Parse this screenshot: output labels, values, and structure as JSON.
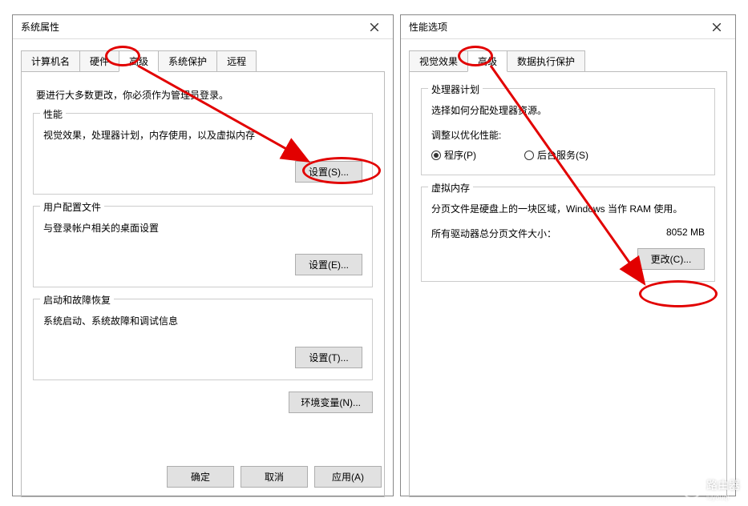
{
  "left": {
    "title": "系统属性",
    "tabs": [
      "计算机名",
      "硬件",
      "高级",
      "系统保护",
      "远程"
    ],
    "active_tab": 2,
    "admin_notice": "要进行大多数更改，你必须作为管理员登录。",
    "perf": {
      "title": "性能",
      "desc": "视觉效果，处理器计划，内存使用，以及虚拟内存",
      "button": "设置(S)..."
    },
    "profiles": {
      "title": "用户配置文件",
      "desc": "与登录帐户相关的桌面设置",
      "button": "设置(E)..."
    },
    "startup": {
      "title": "启动和故障恢复",
      "desc": "系统启动、系统故障和调试信息",
      "button": "设置(T)..."
    },
    "envvars_button": "环境变量(N)...",
    "footer": {
      "ok": "确定",
      "cancel": "取消",
      "apply": "应用(A)"
    }
  },
  "right": {
    "title": "性能选项",
    "tabs": [
      "视觉效果",
      "高级",
      "数据执行保护"
    ],
    "active_tab": 1,
    "sched": {
      "title": "处理器计划",
      "desc": "选择如何分配处理器资源。",
      "adjust_label": "调整以优化性能:",
      "opt_programs": "程序(P)",
      "opt_background": "后台服务(S)"
    },
    "vmem": {
      "title": "虚拟内存",
      "desc": "分页文件是硬盘上的一块区域，Windows 当作 RAM 使用。",
      "total_label": "所有驱动器总分页文件大小：",
      "total_value": "8052 MB",
      "change_button": "更改(C)..."
    }
  },
  "watermark": {
    "text": "路由器",
    "sub": "luyouqi"
  }
}
